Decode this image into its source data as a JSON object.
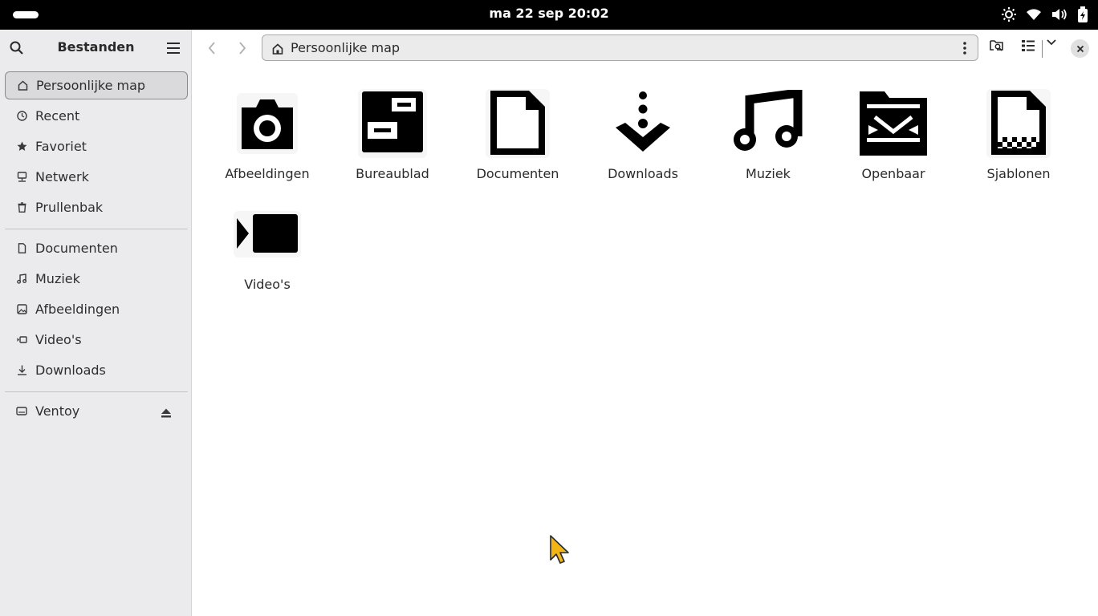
{
  "topbar": {
    "clock": "ma 22 sep  20:02",
    "tray_icons": [
      "brightness-icon",
      "wifi-icon",
      "volume-icon",
      "battery-icon"
    ]
  },
  "sidebar": {
    "title": "Bestanden",
    "places": [
      {
        "label": "Persoonlijke map",
        "icon": "home-icon",
        "active": true
      },
      {
        "label": "Recent",
        "icon": "clock-icon"
      },
      {
        "label": "Favoriet",
        "icon": "star-icon"
      },
      {
        "label": "Netwerk",
        "icon": "network-icon"
      },
      {
        "label": "Prullenbak",
        "icon": "trash-icon"
      }
    ],
    "bookmarks": [
      {
        "label": "Documenten",
        "icon": "document-icon"
      },
      {
        "label": "Muziek",
        "icon": "music-icon"
      },
      {
        "label": "Afbeeldingen",
        "icon": "image-icon"
      },
      {
        "label": "Video's",
        "icon": "video-icon"
      },
      {
        "label": "Downloads",
        "icon": "download-icon"
      }
    ],
    "devices": [
      {
        "label": "Ventoy",
        "icon": "drive-icon"
      }
    ]
  },
  "pathbar": {
    "location": "Persoonlijke map"
  },
  "folders": [
    {
      "label": "Afbeeldingen",
      "icon": "camera-icon"
    },
    {
      "label": "Bureaublad",
      "icon": "desktop-icon"
    },
    {
      "label": "Documenten",
      "icon": "document-icon"
    },
    {
      "label": "Downloads",
      "icon": "download-icon"
    },
    {
      "label": "Muziek",
      "icon": "music-icon"
    },
    {
      "label": "Openbaar",
      "icon": "public-share-icon"
    },
    {
      "label": "Sjablonen",
      "icon": "template-icon"
    },
    {
      "label": "Video's",
      "icon": "video-icon"
    }
  ]
}
